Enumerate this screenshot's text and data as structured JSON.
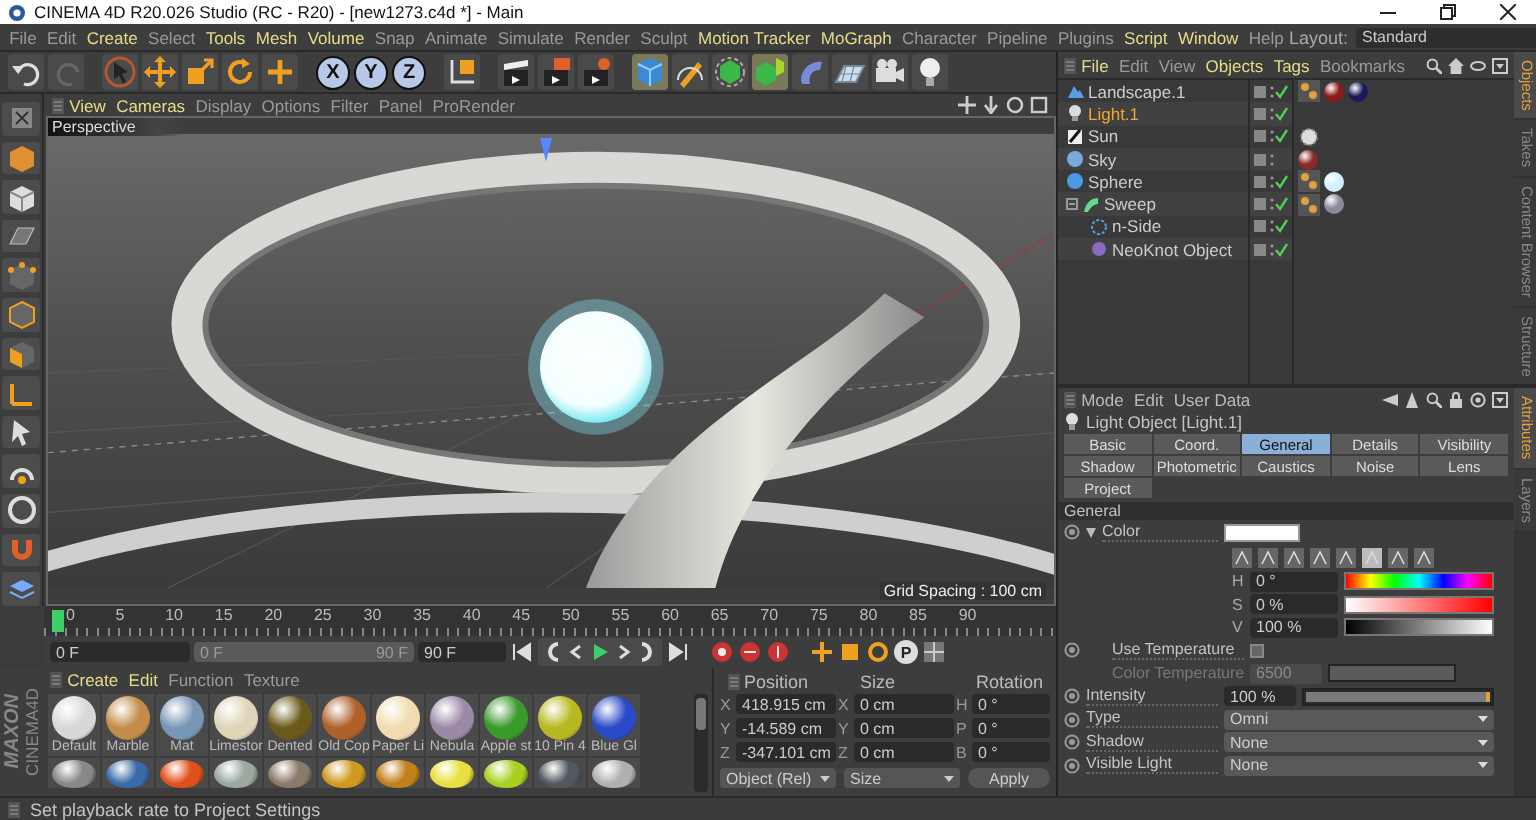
{
  "window": {
    "title": "CINEMA 4D R20.026 Studio (RC - R20) - [new1273.c4d *] - Main"
  },
  "menu": {
    "items": [
      {
        "label": "File",
        "highlighted": false
      },
      {
        "label": "Edit",
        "highlighted": false
      },
      {
        "label": "Create",
        "highlighted": true
      },
      {
        "label": "Select",
        "highlighted": false
      },
      {
        "label": "Tools",
        "highlighted": true
      },
      {
        "label": "Mesh",
        "highlighted": true
      },
      {
        "label": "Volume",
        "highlighted": true
      },
      {
        "label": "Snap",
        "highlighted": false
      },
      {
        "label": "Animate",
        "highlighted": false
      },
      {
        "label": "Simulate",
        "highlighted": false
      },
      {
        "label": "Render",
        "highlighted": false
      },
      {
        "label": "Sculpt",
        "highlighted": false
      },
      {
        "label": "Motion Tracker",
        "highlighted": true
      },
      {
        "label": "MoGraph",
        "highlighted": true
      },
      {
        "label": "Character",
        "highlighted": false
      },
      {
        "label": "Pipeline",
        "highlighted": false
      },
      {
        "label": "Plugins",
        "highlighted": false
      },
      {
        "label": "Script",
        "highlighted": true
      },
      {
        "label": "Window",
        "highlighted": true
      },
      {
        "label": "Help",
        "highlighted": false
      }
    ],
    "layout_label": "Layout:",
    "layout_value": "Standard"
  },
  "toolbar": {
    "axis_buttons": [
      {
        "label": "X",
        "on": true
      },
      {
        "label": "Y",
        "on": true
      },
      {
        "label": "Z",
        "on": true
      }
    ]
  },
  "viewport": {
    "menu": [
      {
        "label": "View",
        "highlighted": true
      },
      {
        "label": "Cameras",
        "highlighted": true
      },
      {
        "label": "Display",
        "highlighted": false
      },
      {
        "label": "Options",
        "highlighted": false
      },
      {
        "label": "Filter",
        "highlighted": false
      },
      {
        "label": "Panel",
        "highlighted": false
      },
      {
        "label": "ProRender",
        "highlighted": false
      }
    ],
    "camera": "Perspective",
    "grid_spacing": "Grid Spacing : 100 cm"
  },
  "timeline": {
    "ticks": [
      "0",
      "5",
      "10",
      "15",
      "20",
      "25",
      "30",
      "35",
      "40",
      "45",
      "50",
      "55",
      "60",
      "65",
      "70",
      "75",
      "80",
      "85",
      "90"
    ],
    "level": 0,
    "frame_start": "0 F",
    "range_start": "0 F",
    "range_end": "90 F",
    "frame_end": "90 F",
    "parameter_key": "P"
  },
  "logo": {
    "brand": "MAXON",
    "product": "CINEMA4D"
  },
  "materials": {
    "menu": [
      {
        "label": "Create",
        "highlighted": true
      },
      {
        "label": "Edit",
        "highlighted": true
      },
      {
        "label": "Function",
        "highlighted": false
      },
      {
        "label": "Texture",
        "highlighted": false
      }
    ],
    "items": [
      {
        "name": "Default",
        "color": "#d8d8d8"
      },
      {
        "name": "Marble",
        "color": "#c48c48"
      },
      {
        "name": "Mat",
        "color": "#7896b8"
      },
      {
        "name": "Limestor",
        "color": "#e0d4b8"
      },
      {
        "name": "Dented",
        "color": "#6a5a1a"
      },
      {
        "name": "Old Cop",
        "color": "#b0602a"
      },
      {
        "name": "Paper Li",
        "color": "#f0dcb0"
      },
      {
        "name": "Nebula",
        "color": "#9a8aa8"
      },
      {
        "name": "Apple st",
        "color": "#3a9a2a"
      },
      {
        "name": "10 Pin 4",
        "color": "#b8b820"
      },
      {
        "name": "Blue Gl",
        "color": "#2a4ac8"
      },
      {
        "color": "#888888"
      },
      {
        "color": "#3a6aa8"
      },
      {
        "color": "#e0501a"
      },
      {
        "color": "#9aa8a0"
      },
      {
        "color": "#8a7a6a"
      },
      {
        "color": "#d09a20"
      },
      {
        "color": "#c0801a"
      },
      {
        "color": "#e8e040"
      },
      {
        "color": "#a8d020"
      },
      {
        "color": "#505860"
      },
      {
        "color": "#b0b0b0"
      }
    ]
  },
  "coordinates": {
    "headers": [
      "Position",
      "Size",
      "Rotation"
    ],
    "rows": [
      {
        "position_axis": "X",
        "position": "418.915 cm",
        "size_axis": "X",
        "size": "0 cm",
        "rotation_axis": "H",
        "rotation": "0 °"
      },
      {
        "position_axis": "Y",
        "position": "-14.589 cm",
        "size_axis": "Y",
        "size": "0 cm",
        "rotation_axis": "P",
        "rotation": "0 °"
      },
      {
        "position_axis": "Z",
        "position": "-347.101 cm",
        "size_axis": "Z",
        "size": "0 cm",
        "rotation_axis": "B",
        "rotation": "0 °"
      }
    ],
    "mode": "Object (Rel)",
    "size_mode": "Size",
    "apply": "Apply"
  },
  "objects": {
    "menu": [
      {
        "label": "File",
        "highlighted": true
      },
      {
        "label": "Edit",
        "highlighted": false
      },
      {
        "label": "View",
        "highlighted": false
      },
      {
        "label": "Objects",
        "highlighted": true
      },
      {
        "label": "Tags",
        "highlighted": true
      },
      {
        "label": "Bookmarks",
        "highlighted": false
      }
    ],
    "rows": [
      {
        "name": "Landscape.1",
        "kind": "landscape",
        "selected": false,
        "enabled": true,
        "tags": [
          {
            "kind": "phong"
          },
          {
            "kind": "material",
            "color": "#8b1a1a"
          },
          {
            "kind": "material",
            "color": "#1a1a5a"
          }
        ]
      },
      {
        "name": "Light.1",
        "kind": "light",
        "selected": true,
        "enabled": true
      },
      {
        "name": "Sun",
        "kind": "sun",
        "selected": false,
        "enabled": true,
        "tags": [
          {
            "kind": "sun"
          }
        ]
      },
      {
        "name": "Sky",
        "kind": "sky",
        "selected": false,
        "enabled": false,
        "tags": [
          {
            "kind": "material",
            "color": "#8a2a2a"
          }
        ]
      },
      {
        "name": "Sphere",
        "kind": "sphere",
        "selected": false,
        "enabled": true,
        "tags": [
          {
            "kind": "phong"
          },
          {
            "kind": "material",
            "color": "#d0f0ff"
          }
        ]
      },
      {
        "name": "Sweep",
        "kind": "sweep",
        "selected": false,
        "enabled": true,
        "expanded": true,
        "tags": [
          {
            "kind": "phong"
          },
          {
            "kind": "material",
            "color": "#8a8a9a"
          }
        ],
        "children": [
          {
            "name": "n-Side",
            "kind": "nside",
            "selected": false,
            "enabled": true
          },
          {
            "name": "NeoKnot Object",
            "kind": "neoknot",
            "selected": false,
            "enabled": true
          }
        ]
      }
    ],
    "side_tabs": [
      {
        "label": "Objects",
        "selected": true
      },
      {
        "label": "Takes",
        "selected": false
      },
      {
        "label": "Content Browser",
        "selected": false
      },
      {
        "label": "Structure",
        "selected": false
      }
    ]
  },
  "attributes": {
    "menu": [
      "Mode",
      "Edit",
      "User Data"
    ],
    "title": "Light Object [Light.1]",
    "tabs": [
      {
        "label": "Basic",
        "selected": false
      },
      {
        "label": "Coord.",
        "selected": false
      },
      {
        "label": "General",
        "selected": true
      },
      {
        "label": "Details",
        "selected": false
      },
      {
        "label": "Visibility",
        "selected": false
      },
      {
        "label": "Shadow",
        "selected": false
      },
      {
        "label": "Photometric",
        "selected": false
      },
      {
        "label": "Caustics",
        "selected": false
      },
      {
        "label": "Noise",
        "selected": false
      },
      {
        "label": "Lens",
        "selected": false
      },
      {
        "label": "Project",
        "selected": false
      }
    ],
    "section": "General",
    "color_param": {
      "label": "Color",
      "color": "#ffffff"
    },
    "hsv": [
      {
        "kind": "hue",
        "label": "H",
        "value": "0 °"
      },
      {
        "kind": "saturation",
        "label": "S",
        "value": "0 %"
      },
      {
        "kind": "value",
        "label": "V",
        "value": "100 %"
      }
    ],
    "params": [
      {
        "kind": "checkbox",
        "label": "Use Temperature",
        "checked": false
      },
      {
        "kind": "number",
        "label": "Color Temperature",
        "value": "6500",
        "disabled": true
      },
      {
        "kind": "slider",
        "label": "Intensity",
        "value": "100 %",
        "level": 1
      },
      {
        "kind": "dropdown",
        "label": "Type",
        "value": "Omni"
      },
      {
        "kind": "dropdown",
        "label": "Shadow",
        "value": "None"
      },
      {
        "kind": "dropdown",
        "label": "Visible Light",
        "value": "None"
      }
    ],
    "side_tabs": [
      {
        "label": "Attributes",
        "selected": true
      },
      {
        "label": "Layers",
        "selected": false
      }
    ]
  },
  "status_bar": {
    "text": "Set playback rate to Project Settings"
  }
}
